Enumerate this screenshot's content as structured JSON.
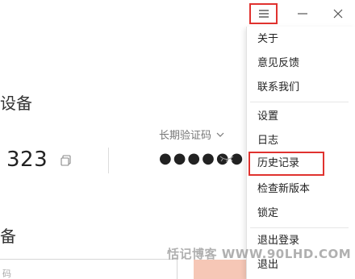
{
  "window": {
    "menu_icon": "hamburger-icon",
    "minimize_icon": "minimize-icon",
    "close_icon": "close-icon"
  },
  "main": {
    "heading1": "设备",
    "verification_label": "长期验证码",
    "device_id": "323",
    "password_mask": "●●●●●●",
    "heading2": "备",
    "input_placeholder": "码"
  },
  "menu": {
    "items": [
      {
        "label": "关于"
      },
      {
        "label": "意见反馈"
      },
      {
        "label": "联系我们"
      },
      {
        "label": "设置"
      },
      {
        "label": "日志"
      },
      {
        "label": "历史记录"
      },
      {
        "label": "检查新版本"
      },
      {
        "label": "锁定"
      },
      {
        "label": "退出登录"
      },
      {
        "label": "退出"
      }
    ]
  },
  "watermark": "恬记博客 WWW.90LHD.COM",
  "colors": {
    "highlight_border": "#e0322f",
    "accent_block": "#f6c7b6"
  }
}
